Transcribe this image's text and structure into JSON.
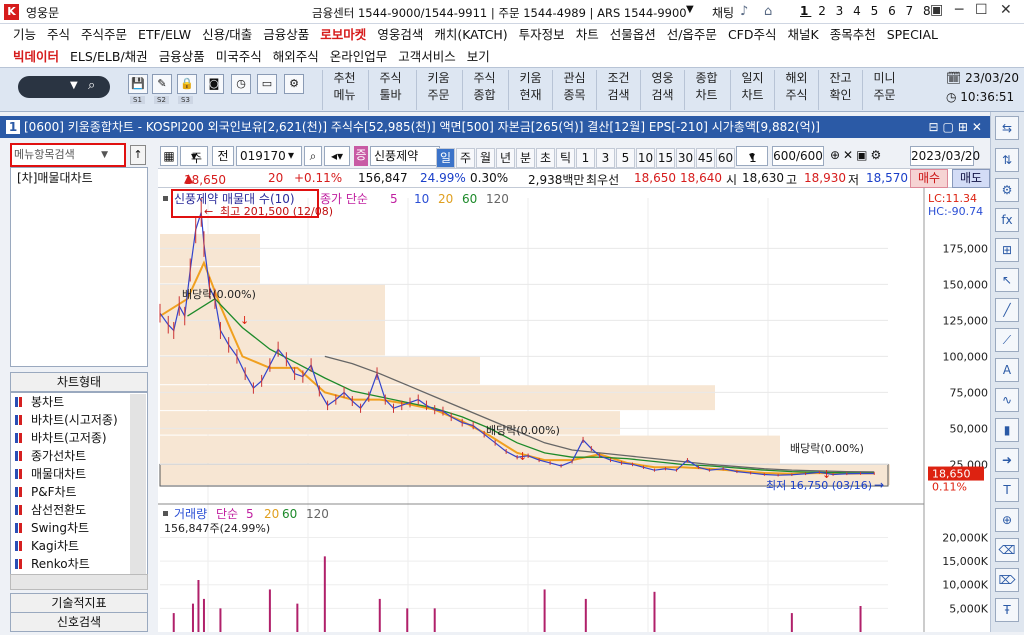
{
  "app": {
    "title": "영웅문"
  },
  "titlebar": {
    "centers": "금융센터 1544-9000/1544-9911 | 주문 1544-4989 | ARS 1544-9900",
    "chat": "채팅",
    "pages": [
      "1",
      "2",
      "3",
      "4",
      "5",
      "6",
      "7",
      "8"
    ]
  },
  "menu1": [
    "기능",
    "주식",
    "주식주문",
    "ETF/ELW",
    "신용/대출",
    "금융상품",
    "로보마켓",
    "영웅검색",
    "캐치(KATCH)",
    "투자정보",
    "차트",
    "선물옵션",
    "선/옵주문",
    "CFD주식",
    "채널K",
    "종목추천",
    "SPECIAL"
  ],
  "menu1_red": "로보마켓",
  "menu2": [
    "빅데이터",
    "ELS/ELB/채권",
    "금융상품",
    "미국주식",
    "해외주식",
    "온라인업무",
    "고객서비스",
    "보기"
  ],
  "menu2_red": "빅데이터",
  "toolbar": {
    "small_labels": [
      "S1",
      "S2",
      "S3"
    ],
    "buttons": [
      [
        "추천",
        "메뉴"
      ],
      [
        "주식",
        "툴바"
      ],
      [
        "키움",
        "주문"
      ],
      [
        "주식",
        "종합"
      ],
      [
        "키움",
        "현재"
      ],
      [
        "관심",
        "종목"
      ],
      [
        "조건",
        "검색"
      ],
      [
        "영웅",
        "검색"
      ],
      [
        "종합",
        "차트"
      ],
      [
        "일지",
        "차트"
      ],
      [
        "해외",
        "주식"
      ],
      [
        "잔고",
        "확인"
      ],
      [
        "미니",
        "주문"
      ]
    ],
    "date": "23/03/20",
    "time": "10:36:51"
  },
  "window": {
    "num": "1",
    "title": "[0600] 키움종합차트 - KOSPI200 외국인보유[2,621(천)] 주식수[52,985(천)] 액면[500] 자본금[265(억)] 결산[12월] EPS[-210] 시가총액[9,882(억)]"
  },
  "left": {
    "search_placeholder": "메뉴항목검색",
    "items": [
      "[차]매물대차트"
    ],
    "chart_type_header": "차트형태",
    "chart_types": [
      "봉차트",
      "바차트(시고저종)",
      "바차트(고저종)",
      "종가선차트",
      "매물대차트",
      "P&F차트",
      "삼선전환도",
      "Swing차트",
      "Kagi차트",
      "Renko차트"
    ],
    "tech": "기술적지표",
    "signal": "신호검색"
  },
  "ctool": {
    "week": "주",
    "jeon": "전",
    "code": "019170",
    "name": "신풍제약",
    "tfs": [
      "일",
      "주",
      "월",
      "년",
      "분",
      "초",
      "틱"
    ],
    "nums": [
      "1",
      "3",
      "5",
      "10",
      "15",
      "30",
      "45",
      "60"
    ],
    "sel": "1",
    "count": "600/600",
    "date": "2023/03/20"
  },
  "quote": {
    "price": "18,650",
    "chg": "20",
    "pct": "+0.11%",
    "vol": "156,847",
    "vpct": "24.99%",
    "rate": "0.30%",
    "amt": "2,938백만",
    "broker": "최우선",
    "ask": "18,650",
    "bid": "18,640",
    "open_l": "시",
    "open": "18,630",
    "high_l": "고",
    "high": "18,930",
    "low_l": "저",
    "low": "18,570",
    "buy": "매수",
    "sell": "매도"
  },
  "chart_data": {
    "type": "line",
    "title": "신풍제약 매물대 수(10)",
    "legend": {
      "close": "종가 단순",
      "ma": [
        "5",
        "10",
        "20",
        "60",
        "120"
      ]
    },
    "max_label": "최고 201,500 (12/08)",
    "min_label": "최저 16,750 (03/16)",
    "dividends": [
      "배당락(0.00%)",
      "배당락(0.00%)",
      "배당락(0.00%)"
    ],
    "lc": "LC:11.34",
    "hc": "HC:-90.74",
    "y_ticks": [
      "175,000",
      "150,000",
      "125,000",
      "100,000",
      "75,000",
      "50,000",
      "25,000"
    ],
    "y_range": [
      10000,
      210000
    ],
    "last": {
      "price": "18,650",
      "pct": "0.11%"
    },
    "price": [
      [
        0,
        130000
      ],
      [
        3,
        122000
      ],
      [
        5,
        118000
      ],
      [
        7,
        135000
      ],
      [
        9,
        128000
      ],
      [
        11,
        160000
      ],
      [
        13,
        188000
      ],
      [
        15,
        200000
      ],
      [
        16,
        178000
      ],
      [
        18,
        148000
      ],
      [
        20,
        140000
      ],
      [
        22,
        118000
      ],
      [
        25,
        108000
      ],
      [
        28,
        100000
      ],
      [
        31,
        88000
      ],
      [
        34,
        78000
      ],
      [
        37,
        83000
      ],
      [
        40,
        94000
      ],
      [
        43,
        105000
      ],
      [
        46,
        98000
      ],
      [
        49,
        88000
      ],
      [
        52,
        86000
      ],
      [
        55,
        94000
      ],
      [
        58,
        76000
      ],
      [
        61,
        66000
      ],
      [
        64,
        70000
      ],
      [
        67,
        75000
      ],
      [
        70,
        69000
      ],
      [
        73,
        64000
      ],
      [
        76,
        72000
      ],
      [
        79,
        88000
      ],
      [
        82,
        70000
      ],
      [
        85,
        64000
      ],
      [
        88,
        66000
      ],
      [
        91,
        68000
      ],
      [
        94,
        70000
      ],
      [
        97,
        66000
      ],
      [
        100,
        63000
      ],
      [
        103,
        62000
      ],
      [
        106,
        58000
      ],
      [
        110,
        54000
      ],
      [
        114,
        52000
      ],
      [
        118,
        46000
      ],
      [
        122,
        40000
      ],
      [
        126,
        34000
      ],
      [
        130,
        30000
      ],
      [
        134,
        31000
      ],
      [
        138,
        28000
      ],
      [
        142,
        26000
      ],
      [
        146,
        24000
      ],
      [
        150,
        27000
      ],
      [
        154,
        42000
      ],
      [
        157,
        36000
      ],
      [
        160,
        31000
      ],
      [
        164,
        28000
      ],
      [
        168,
        26000
      ],
      [
        172,
        25000
      ],
      [
        176,
        23000
      ],
      [
        180,
        21000
      ],
      [
        184,
        22000
      ],
      [
        188,
        21000
      ],
      [
        192,
        28000
      ],
      [
        196,
        23000
      ],
      [
        200,
        21000
      ],
      [
        205,
        22000
      ],
      [
        210,
        20000
      ],
      [
        215,
        19000
      ],
      [
        220,
        18000
      ],
      [
        225,
        17500
      ],
      [
        230,
        17800
      ],
      [
        235,
        18500
      ],
      [
        240,
        19500
      ],
      [
        245,
        18000
      ],
      [
        250,
        18500
      ],
      [
        255,
        18700
      ],
      [
        260,
        18650
      ]
    ],
    "ma_lines": [
      {
        "name": "20",
        "color": "#f0a020",
        "pts": [
          [
            0,
            128000
          ],
          [
            10,
            140000
          ],
          [
            16,
            165000
          ],
          [
            22,
            135000
          ],
          [
            30,
            100000
          ],
          [
            40,
            92000
          ],
          [
            50,
            92000
          ],
          [
            60,
            75000
          ],
          [
            70,
            70000
          ],
          [
            80,
            70000
          ],
          [
            90,
            67000
          ],
          [
            100,
            63000
          ],
          [
            110,
            55000
          ],
          [
            120,
            45000
          ],
          [
            130,
            33000
          ],
          [
            140,
            28000
          ],
          [
            150,
            28000
          ],
          [
            160,
            32000
          ],
          [
            170,
            26000
          ],
          [
            180,
            23000
          ],
          [
            190,
            23000
          ],
          [
            200,
            22000
          ],
          [
            210,
            20500
          ],
          [
            220,
            19000
          ],
          [
            230,
            18500
          ],
          [
            240,
            19000
          ],
          [
            250,
            18600
          ],
          [
            260,
            18800
          ]
        ]
      },
      {
        "name": "60",
        "color": "#1d8a2a",
        "pts": [
          [
            10,
            128000
          ],
          [
            20,
            140000
          ],
          [
            30,
            120000
          ],
          [
            40,
            105000
          ],
          [
            50,
            95000
          ],
          [
            60,
            85000
          ],
          [
            70,
            76000
          ],
          [
            80,
            72000
          ],
          [
            90,
            68000
          ],
          [
            100,
            64000
          ],
          [
            110,
            58000
          ],
          [
            120,
            50000
          ],
          [
            130,
            40000
          ],
          [
            140,
            33000
          ],
          [
            150,
            30000
          ],
          [
            160,
            30000
          ],
          [
            170,
            29000
          ],
          [
            180,
            27000
          ],
          [
            190,
            25000
          ],
          [
            200,
            24000
          ],
          [
            210,
            22500
          ],
          [
            220,
            21000
          ],
          [
            230,
            20000
          ],
          [
            240,
            19500
          ],
          [
            250,
            19200
          ],
          [
            260,
            19000
          ]
        ]
      },
      {
        "name": "120",
        "color": "#666666",
        "pts": [
          [
            60,
            100000
          ],
          [
            70,
            95000
          ],
          [
            80,
            88000
          ],
          [
            90,
            80000
          ],
          [
            100,
            72000
          ],
          [
            110,
            64000
          ],
          [
            120,
            56000
          ],
          [
            130,
            48000
          ],
          [
            140,
            40000
          ],
          [
            150,
            35000
          ],
          [
            160,
            33000
          ],
          [
            170,
            31000
          ],
          [
            180,
            29000
          ],
          [
            190,
            27000
          ],
          [
            200,
            25000
          ],
          [
            210,
            23500
          ],
          [
            220,
            22000
          ],
          [
            230,
            21000
          ],
          [
            240,
            20500
          ],
          [
            250,
            20000
          ],
          [
            260,
            19800
          ]
        ]
      }
    ],
    "profile": [
      {
        "lo": 150000,
        "hi": 162000,
        "w": 100
      },
      {
        "lo": 100000,
        "hi": 150000,
        "w": 225
      },
      {
        "lo": 80000,
        "hi": 100000,
        "w": 320
      },
      {
        "lo": 62000,
        "hi": 80000,
        "w": 555
      },
      {
        "lo": 45000,
        "hi": 62000,
        "w": 460
      },
      {
        "lo": 25000,
        "hi": 45000,
        "w": 620
      },
      {
        "lo": 10000,
        "hi": 25000,
        "w": 730
      },
      {
        "lo": 162000,
        "hi": 185000,
        "w": 100
      }
    ],
    "volume": {
      "title": "거래량",
      "legend": "단순",
      "ma": [
        "5",
        "20",
        "60",
        "120"
      ],
      "last": "156,847주(24.99%)",
      "y_ticks": [
        "20,000K",
        "15,000K",
        "10,000K",
        "5,000K"
      ],
      "y_range": [
        0,
        22000
      ],
      "bars": [
        [
          5,
          4000
        ],
        [
          12,
          6000
        ],
        [
          14,
          11000
        ],
        [
          16,
          7000
        ],
        [
          22,
          5000
        ],
        [
          40,
          9000
        ],
        [
          50,
          6000
        ],
        [
          60,
          16000
        ],
        [
          80,
          7000
        ],
        [
          90,
          5000
        ],
        [
          100,
          5000
        ],
        [
          140,
          9000
        ],
        [
          155,
          7000
        ],
        [
          180,
          8500
        ],
        [
          230,
          4000
        ],
        [
          255,
          5500
        ]
      ]
    }
  }
}
